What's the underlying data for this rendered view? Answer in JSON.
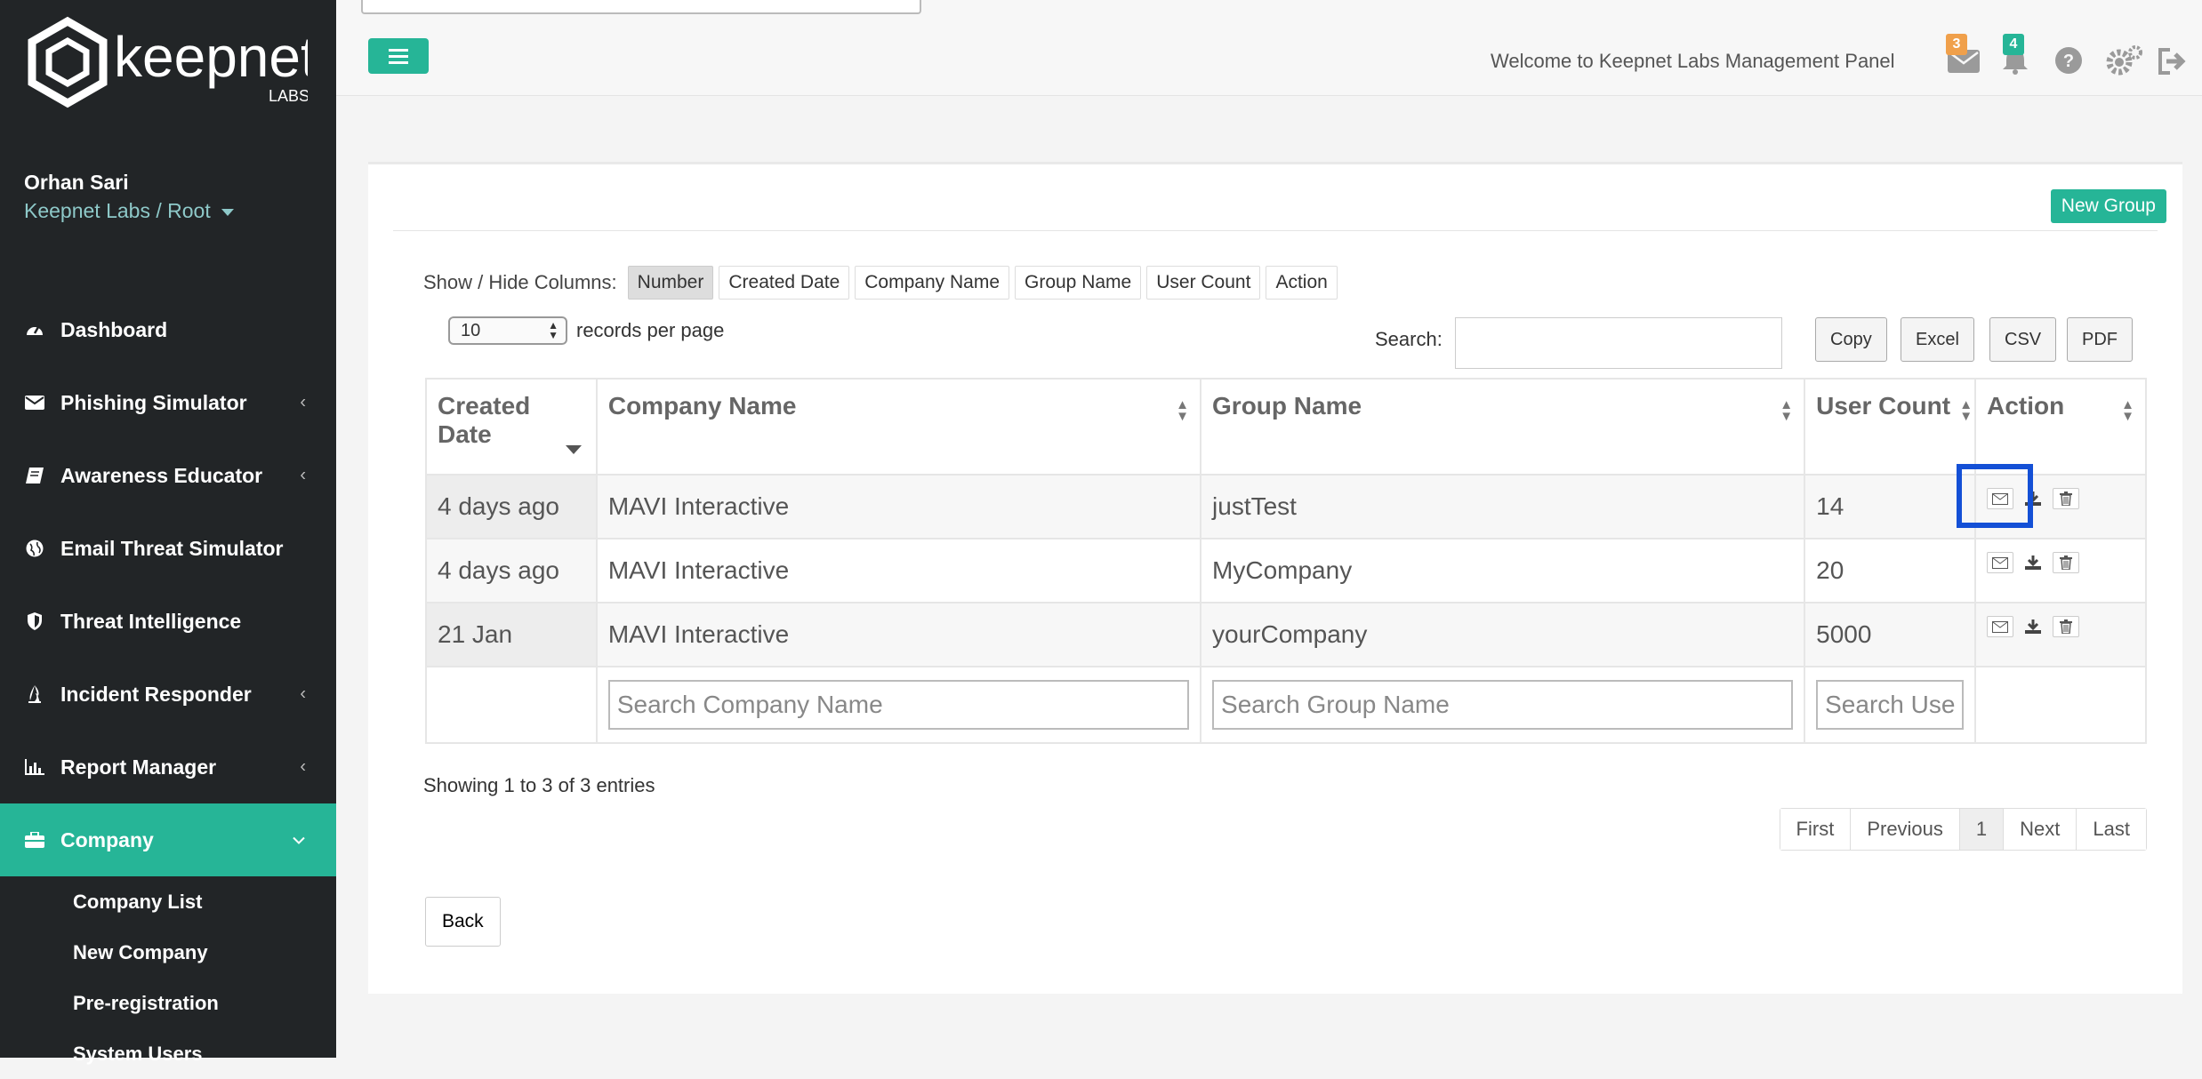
{
  "brand": {
    "name": "keepnet",
    "sub": "LABS"
  },
  "user": {
    "name": "Orhan Sari",
    "org": "Keepnet Labs / Root"
  },
  "nav": [
    {
      "label": "Dashboard"
    },
    {
      "label": "Phishing Simulator"
    },
    {
      "label": "Awareness Educator"
    },
    {
      "label": "Email Threat Simulator"
    },
    {
      "label": "Threat Intelligence"
    },
    {
      "label": "Incident Responder"
    },
    {
      "label": "Report Manager"
    },
    {
      "label": "Company"
    }
  ],
  "subnav": [
    "Company List",
    "New Company",
    "Pre-registration",
    "System Users"
  ],
  "header": {
    "welcome": "Welcome to Keepnet Labs Management Panel",
    "mail_count": "3",
    "notif_count": "4"
  },
  "panel": {
    "new_group": "New Group"
  },
  "columns_bar": {
    "label": "Show / Hide Columns:",
    "buttons": [
      "Number",
      "Created Date",
      "Company Name",
      "Group Name",
      "User Count",
      "Action"
    ]
  },
  "length": {
    "value": "10",
    "label": "records per page"
  },
  "search": {
    "label": "Search:"
  },
  "export": [
    "Copy",
    "Excel",
    "CSV",
    "PDF"
  ],
  "table": {
    "headers": {
      "created_a": "Created",
      "created_b": "Date",
      "company": "Company Name",
      "group": "Group Name",
      "count": "User Count",
      "action": "Action"
    },
    "rows": [
      {
        "created": "4 days ago",
        "company": "MAVI Interactive",
        "group": "justTest",
        "count": "14"
      },
      {
        "created": "4 days ago",
        "company": "MAVI Interactive",
        "group": "MyCompany",
        "count": "20"
      },
      {
        "created": "21 Jan",
        "company": "MAVI Interactive",
        "group": "yourCompany",
        "count": "5000"
      }
    ],
    "filters": {
      "company": "Search Company Name",
      "group": "Search Group Name",
      "count": "Search Use"
    }
  },
  "info": "Showing 1 to 3 of 3 entries",
  "pager": [
    "First",
    "Previous",
    "1",
    "Next",
    "Last"
  ],
  "back": "Back",
  "colors": {
    "accent": "#26b597",
    "sidebar": "#222527",
    "highlight": "#1450d6",
    "mail_badge": "#f0a04b",
    "notif_badge": "#26b597"
  }
}
